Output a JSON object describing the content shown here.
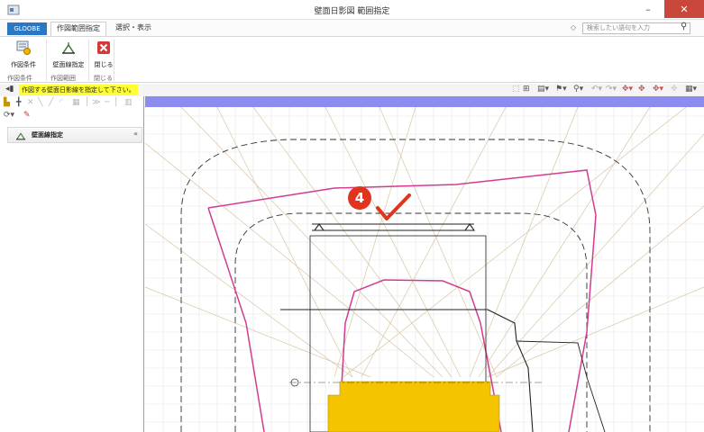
{
  "window": {
    "title": "壁面日影図 範囲指定",
    "minimize_glyph": "–",
    "maximize_glyph": "□",
    "close_glyph": "✕",
    "app_icon": "app-logo-icon"
  },
  "tabs": {
    "file": "GLOOBE",
    "items": [
      {
        "label": "作図範囲指定",
        "active": true
      },
      {
        "label": "選択・表示",
        "active": false
      }
    ]
  },
  "search": {
    "placeholder": "検索したい語句を入力",
    "help_icon": "help-icon",
    "search_icon": "search-icon"
  },
  "ribbon": {
    "buttons": [
      {
        "label": "作図条件",
        "icon": "drawing-conditions-icon"
      },
      {
        "label": "壁面線指定",
        "icon": "wall-line-icon"
      },
      {
        "label": "閉じる",
        "icon": "close-red-icon"
      }
    ],
    "groups": [
      "作図条件",
      "作図範囲",
      "閉じる"
    ]
  },
  "message": {
    "text": "作図する壁面日影線を指定して下さい。"
  },
  "panel": {
    "header": "壁面線指定",
    "chevron": "«"
  },
  "annotation": {
    "step_number": "4"
  },
  "colors": {
    "accent": "#2a78c4",
    "shadow_line": "#d33b8f",
    "building_fill": "#f5c400",
    "message_bg": "#ffff33",
    "canvas_bar": "#8b8bf0",
    "close_button": "#c9483b"
  }
}
